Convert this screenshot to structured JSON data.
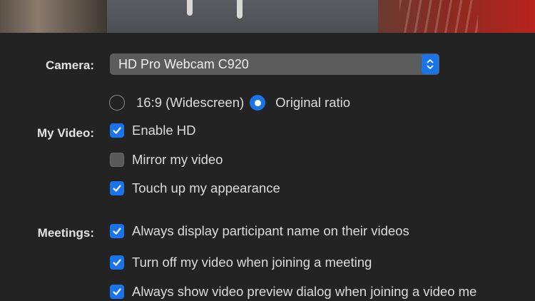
{
  "camera": {
    "label": "Camera:",
    "selected": "HD Pro Webcam C920",
    "stepper_icon": "chevron-up-down-icon"
  },
  "aspect": {
    "option1": {
      "label": "16:9 (Widescreen)",
      "selected": false
    },
    "option2": {
      "label": "Original ratio",
      "selected": true
    }
  },
  "my_video": {
    "label": "My Video:",
    "items": [
      {
        "label": "Enable HD",
        "checked": true
      },
      {
        "label": "Mirror my video",
        "checked": false
      },
      {
        "label": "Touch up my appearance",
        "checked": true
      }
    ]
  },
  "meetings": {
    "label": "Meetings:",
    "items": [
      {
        "label": "Always display participant name on their videos",
        "checked": true
      },
      {
        "label": "Turn off my video when joining a meeting",
        "checked": true
      },
      {
        "label": "Always show video preview dialog when joining a video me",
        "checked": true
      }
    ]
  },
  "colors": {
    "accent": "#1a73e8",
    "background": "#232323"
  }
}
